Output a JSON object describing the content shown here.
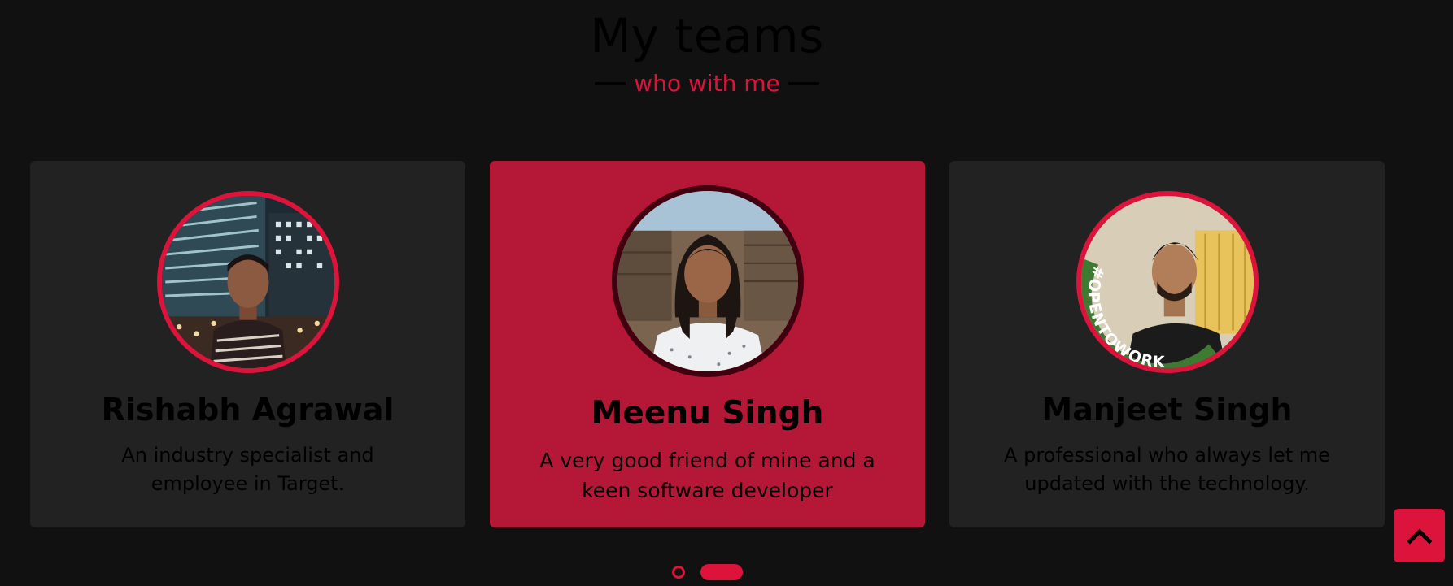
{
  "section": {
    "title": "My teams",
    "subtitle": "who with me"
  },
  "cards": [
    {
      "name": "Rishabh Agrawal",
      "description": "An industry specialist and employee in Target.",
      "active": false
    },
    {
      "name": "Meenu Singh",
      "description": "A very good friend of mine and a keen software developer",
      "active": true
    },
    {
      "name": "Manjeet Singh",
      "description": "A professional who always let me updated with the technology.",
      "active": false,
      "badge": "#OPENTOWORK"
    }
  ],
  "carousel": {
    "page_count": 2,
    "current_page": 2
  },
  "icons": {
    "scroll_top": "chevron-up-icon"
  },
  "colors": {
    "background": "#111111",
    "card": "#222222",
    "accent": "#dc143c",
    "active_card": "#b51736"
  }
}
